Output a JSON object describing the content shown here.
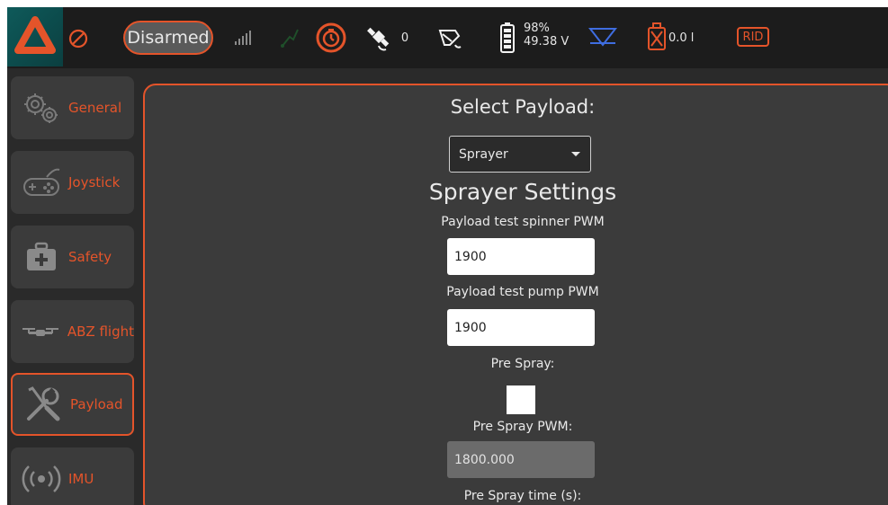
{
  "topbar": {
    "arm_state": "Disarmed",
    "satellite_count": "0",
    "battery_percent": "98%",
    "battery_voltage": "49.38 V",
    "tank_level": "0.0 l",
    "rid_label": "RID",
    "icons": {
      "logo": "triangle-logo-icon",
      "no_entry": "no-entry-icon",
      "signal": "signal-bars-icon",
      "rc": "rc-link-icon",
      "rtk": "rtk-timer-icon",
      "gps": "satellite-icon",
      "telemetry": "telemetry-icon",
      "battery": "battery-icon",
      "spray": "spray-icon",
      "tank": "tank-icon"
    },
    "colors": {
      "accent": "#e4542a",
      "blue": "#3f6de0"
    }
  },
  "sidebar": {
    "items": [
      {
        "label": "General",
        "icon": "gears-icon"
      },
      {
        "label": "Joystick",
        "icon": "gamepad-icon"
      },
      {
        "label": "Safety",
        "icon": "first-aid-icon"
      },
      {
        "label": "ABZ flight",
        "icon": "drone-icon"
      },
      {
        "label": "Payload",
        "icon": "wrench-screwdriver-icon",
        "active": true
      },
      {
        "label": "IMU",
        "icon": "radio-waves-icon"
      }
    ]
  },
  "main": {
    "select_payload_label": "Select Payload:",
    "payload_selected": "Sprayer",
    "section_title": "Sprayer Settings",
    "spinner_pwm_label": "Payload test spinner PWM",
    "spinner_pwm_value": "1900",
    "pump_pwm_label": "Payload test pump PWM",
    "pump_pwm_value": "1900",
    "pre_spray_label": "Pre Spray:",
    "pre_spray_pwm_label": "Pre Spray PWM:",
    "pre_spray_pwm_value": "1800.000",
    "pre_spray_time_label": "Pre Spray time (s):"
  }
}
